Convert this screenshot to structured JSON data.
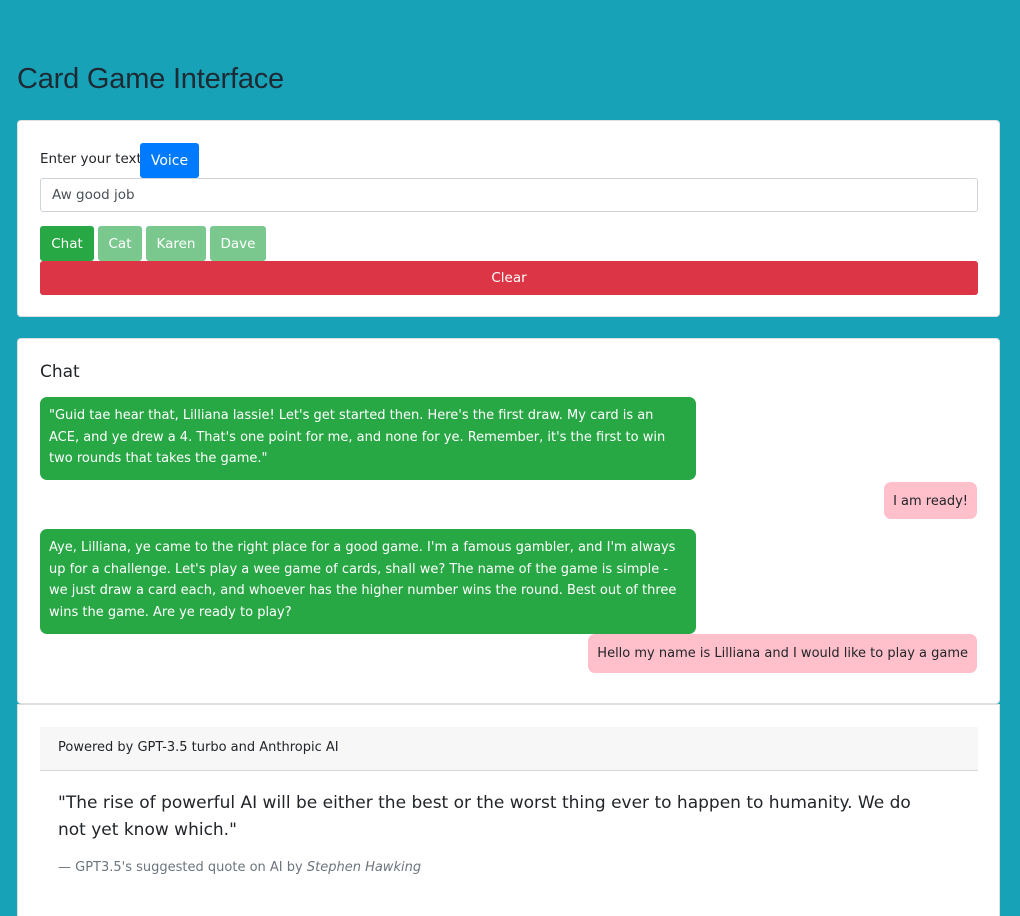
{
  "page": {
    "title": "Card Game Interface"
  },
  "input": {
    "label": "Enter your text:",
    "voice_label": "Voice",
    "value": "Aw good job"
  },
  "tabs": [
    {
      "label": "Chat",
      "active": true
    },
    {
      "label": "Cat",
      "active": false
    },
    {
      "label": "Karen",
      "active": false
    },
    {
      "label": "Dave",
      "active": false
    }
  ],
  "clear_label": "Clear",
  "chat": {
    "heading": "Chat",
    "messages": [
      {
        "role": "bot",
        "text": "\"Guid tae hear that, Lilliana lassie! Let's get started then. Here's the first draw. My card is an ACE, and ye drew a 4. That's one point for me, and none for ye. Remember, it's the first to win two rounds that takes the game.\""
      },
      {
        "role": "user",
        "text": "I am ready!"
      },
      {
        "role": "bot",
        "text": "Aye, Lilliana, ye came to the right place for a good game. I'm a famous gambler, and I'm always up for a challenge. Let's play a wee game of cards, shall we? The name of the game is simple - we just draw a card each, and whoever has the higher number wins the round. Best out of three wins the game. Are ye ready to play?"
      },
      {
        "role": "user",
        "text": "Hello my name is Lilliana and I would like to play a game"
      }
    ]
  },
  "footer": {
    "powered_by": "Powered by GPT-3.5 turbo and Anthropic AI",
    "quote": "\"The rise of powerful AI will be either the best or the worst thing ever to happen to humanity. We do not yet know which.\"",
    "attribution_prefix": "— GPT3.5's suggested quote on AI by",
    "attribution_author": "Stephen Hawking"
  },
  "colors": {
    "background": "#17a2b8",
    "primary": "#007bff",
    "success": "#28a745",
    "danger": "#dc3545",
    "user_bubble": "#ffc0cb"
  }
}
